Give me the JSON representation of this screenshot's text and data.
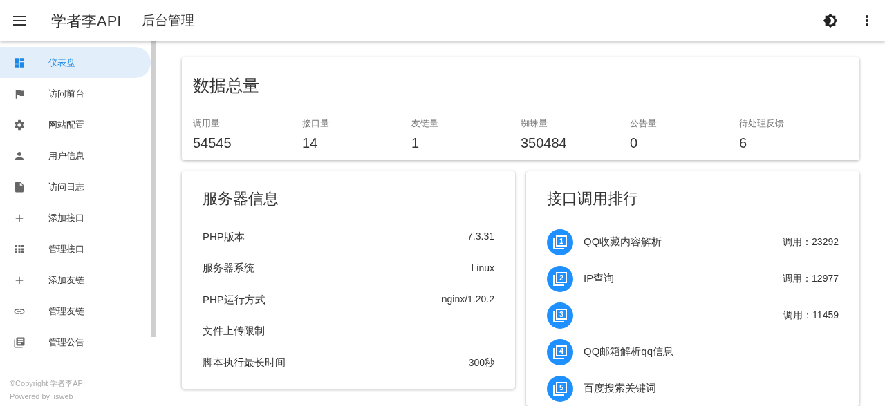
{
  "header": {
    "brand": "学者李API",
    "subtitle": "后台管理"
  },
  "sidebar": {
    "items": [
      {
        "label": "仪表盘",
        "selected": true
      },
      {
        "label": "访问前台",
        "selected": false
      },
      {
        "label": "网站配置",
        "selected": false
      },
      {
        "label": "用户信息",
        "selected": false
      },
      {
        "label": "访问日志",
        "selected": false
      },
      {
        "label": "添加接口",
        "selected": false
      },
      {
        "label": "管理接口",
        "selected": false
      },
      {
        "label": "添加友链",
        "selected": false
      },
      {
        "label": "管理友链",
        "selected": false
      },
      {
        "label": "管理公告",
        "selected": false
      }
    ],
    "footer": [
      "©Copyright 学者李API",
      "Powered by lisweb"
    ]
  },
  "totals": {
    "title": "数据总量",
    "stats": [
      {
        "label": "调用量",
        "value": "54545"
      },
      {
        "label": "接口量",
        "value": "14"
      },
      {
        "label": "友链量",
        "value": "1"
      },
      {
        "label": "蜘蛛量",
        "value": "350484"
      },
      {
        "label": "公告量",
        "value": "0"
      },
      {
        "label": "待处理反馈",
        "value": "6"
      }
    ]
  },
  "server": {
    "title": "服务器信息",
    "rows": [
      {
        "label": "PHP版本",
        "value": "7.3.31"
      },
      {
        "label": "服务器系统",
        "value": "Linux"
      },
      {
        "label": "PHP运行方式",
        "value": "nginx/1.20.2"
      },
      {
        "label": "文件上传限制"
      },
      {
        "label": "脚本执行最长时间",
        "value": "300秒"
      }
    ]
  },
  "ranking": {
    "title": "接口调用排行",
    "items": [
      {
        "rank": "1",
        "name": "QQ收藏内容解析",
        "calls": "调用：23292"
      },
      {
        "rank": "2",
        "name": "IP查询",
        "calls": "调用：12977"
      },
      {
        "rank": "3",
        "calls": "调用：11459"
      },
      {
        "rank": "4",
        "name": "QQ邮箱解析qq信息"
      },
      {
        "rank": "5",
        "name": "百度搜索关键词"
      }
    ]
  }
}
